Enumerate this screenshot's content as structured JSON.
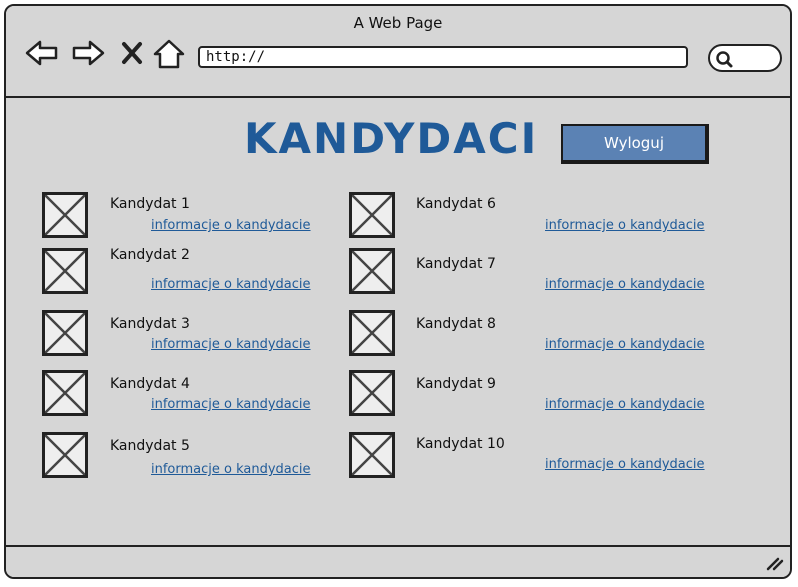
{
  "window": {
    "title": "A Web Page"
  },
  "toolbar": {
    "url": "http://"
  },
  "page": {
    "title": "KANDYDACI",
    "logout_label": "Wyloguj"
  },
  "candidates": [
    {
      "name": "Kandydat 1",
      "link": "informacje o kandydacie"
    },
    {
      "name": "Kandydat 2",
      "link": "informacje o kandydacie"
    },
    {
      "name": "Kandydat 3",
      "link": "informacje o kandydacie"
    },
    {
      "name": "Kandydat 4",
      "link": "informacje o kandydacie"
    },
    {
      "name": "Kandydat 5",
      "link": "informacje o kandydacie"
    },
    {
      "name": "Kandydat 6",
      "link": "informacje o kandydacie"
    },
    {
      "name": "Kandydat 7",
      "link": "informacje o kandydacie"
    },
    {
      "name": "Kandydat 8",
      "link": "informacje o kandydacie"
    },
    {
      "name": "Kandydat 9",
      "link": "informacje o kandydacie"
    },
    {
      "name": "Kandydat 10",
      "link": "informacje o kandydacie"
    }
  ],
  "icons": [
    "back-arrow-icon",
    "forward-arrow-icon",
    "close-icon",
    "home-icon",
    "search-icon",
    "resize-grip-icon",
    "image-placeholder-icon"
  ],
  "colors": {
    "accent": "#1f5a98",
    "button": "#5b82b4",
    "chrome": "#d6d6d6"
  }
}
